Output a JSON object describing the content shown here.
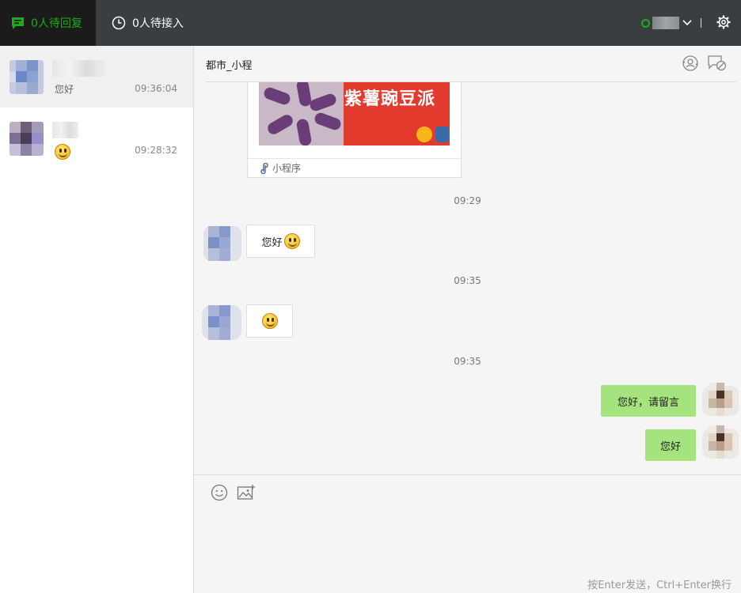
{
  "topbar": {
    "tab_reply": "0人待回复",
    "tab_queue": "0人待接入",
    "accent": "#1aad19"
  },
  "conversations": [
    {
      "message": "您好",
      "time": "09:36:04",
      "active": true
    },
    {
      "message": "",
      "emoji": "smile-emoji",
      "time": "09:28:32",
      "active": false
    }
  ],
  "chat": {
    "title": "都市_小程",
    "card": {
      "banner_text": "紫薯豌豆派",
      "footer_label": "小程序"
    },
    "timestamps": [
      "09:29",
      "09:35",
      "09:35"
    ],
    "messages": [
      {
        "direction": "in",
        "text": "您好",
        "emoji": "smile-emoji"
      },
      {
        "direction": "in",
        "text": "",
        "emoji": "smile-emoji"
      },
      {
        "direction": "out",
        "text": "您好，请留言"
      },
      {
        "direction": "out",
        "text": "您好"
      }
    ],
    "bubble_out_color": "#a4e37e"
  },
  "composer": {
    "hint": "按Enter发送，Ctrl+Enter换行",
    "tools": [
      "emoji-icon",
      "image-icon"
    ]
  }
}
